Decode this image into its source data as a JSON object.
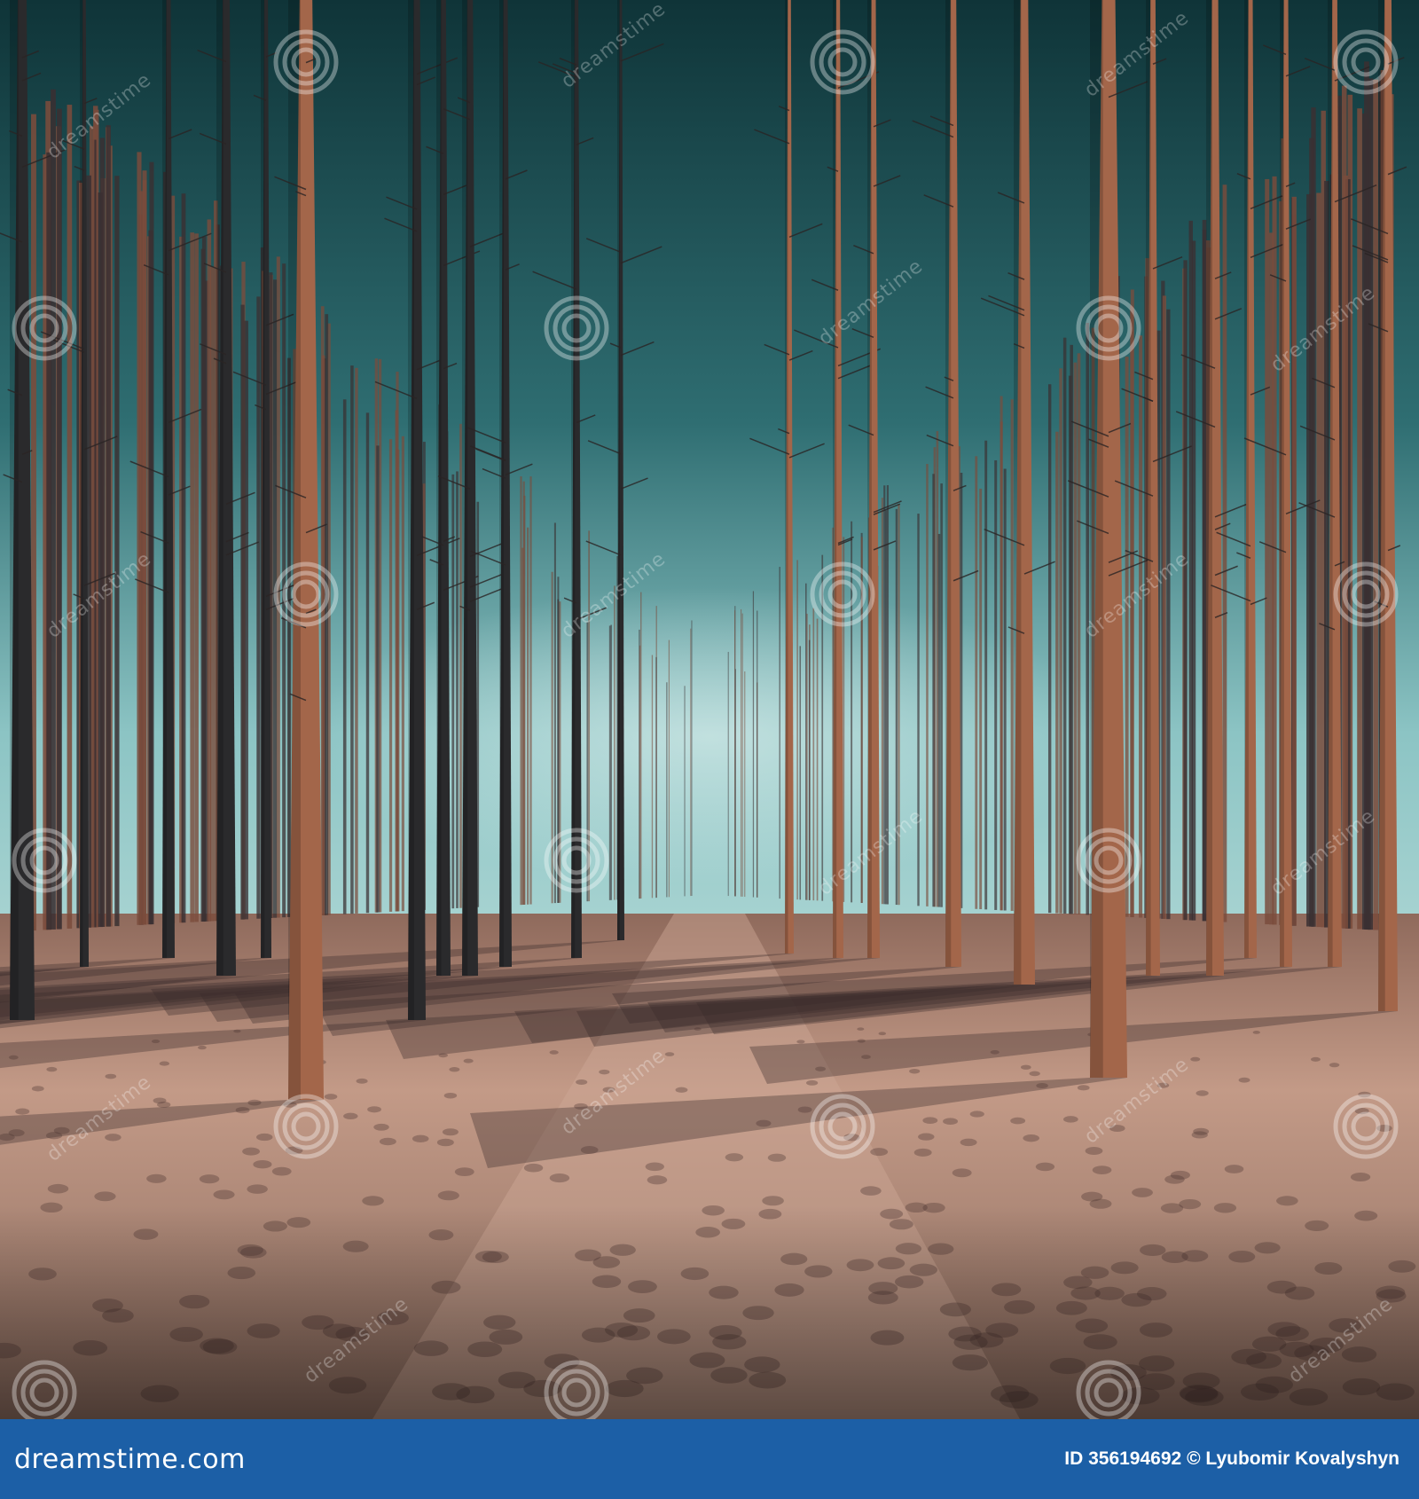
{
  "footer": {
    "logo_text": "dreamstime.com",
    "image_id_label": "ID",
    "image_id": "356194692",
    "copyright_symbol": "©",
    "author": "Lyubomir Kovalyshyn"
  },
  "watermark": {
    "text": "dreamstime",
    "icon": "spiral-logo-icon"
  },
  "colors": {
    "footer_bar": "#1c5fa6",
    "sky_top": "#123a40",
    "sky_horizon": "#9fd0d0",
    "trunk_lit": "#a3664a",
    "trunk_shadow": "#2a2a2c",
    "sand": "#c79e8b"
  }
}
